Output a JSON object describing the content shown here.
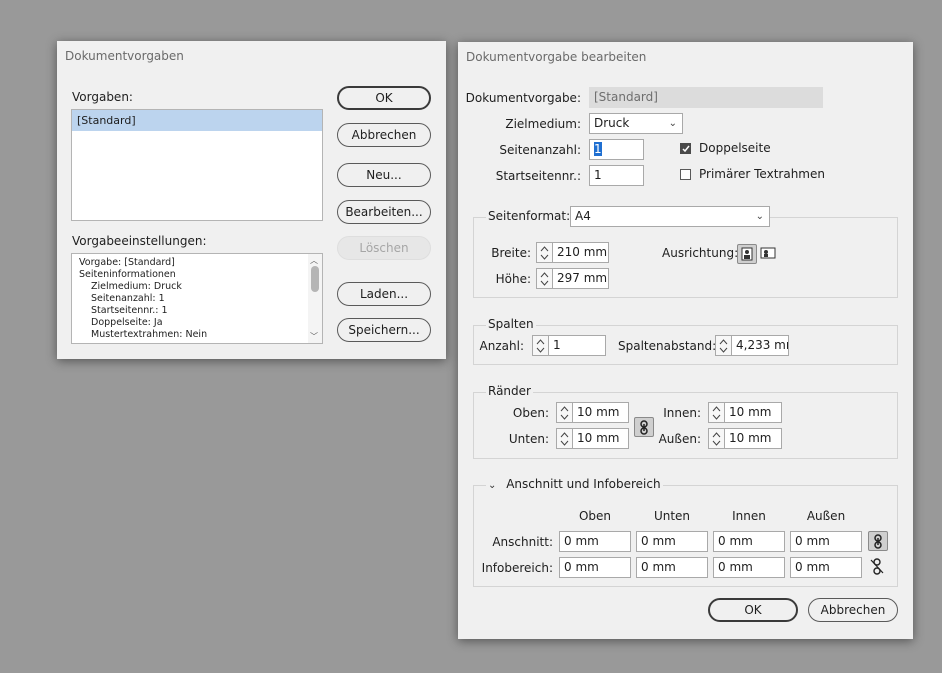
{
  "left_dialog": {
    "title": "Dokumentvorgaben",
    "presets_label": "Vorgaben:",
    "presets": [
      "[Standard]"
    ],
    "settings_label": "Vorgabeeinstellungen:",
    "settings_lines": [
      "Vorgabe: [Standard]",
      "Seiteninformationen",
      "Zielmedium: Druck",
      "Seitenanzahl: 1",
      "Startseitennr.: 1",
      "Doppelseite: Ja",
      "Mustertextrahmen: Nein"
    ],
    "buttons": {
      "ok": "OK",
      "cancel": "Abbrechen",
      "new": "Neu...",
      "edit": "Bearbeiten...",
      "delete": "Löschen",
      "load": "Laden...",
      "save": "Speichern..."
    }
  },
  "right_dialog": {
    "title": "Dokumentvorgabe bearbeiten",
    "preset_label": "Dokumentvorgabe:",
    "preset_value": "[Standard]",
    "medium_label": "Zielmedium:",
    "medium_value": "Druck",
    "page_count_label": "Seitenanzahl:",
    "page_count_value": "1",
    "start_page_label": "Startseitennr.:",
    "start_page_value": "1",
    "facing_pages_label": "Doppelseite",
    "facing_pages_checked": true,
    "primary_frame_label": "Primärer Textrahmen",
    "primary_frame_checked": false,
    "page_size_label": "Seitenformat:",
    "page_size_value": "A4",
    "width_label": "Breite:",
    "width_value": "210 mm",
    "height_label": "Höhe:",
    "height_value": "297 mm",
    "orientation_label": "Ausrichtung:",
    "columns": {
      "title": "Spalten",
      "count_label": "Anzahl:",
      "count_value": "1",
      "gutter_label": "Spaltenabstand:",
      "gutter_value": "4,233 mı"
    },
    "margins": {
      "title": "Ränder",
      "top_label": "Oben:",
      "top_value": "10 mm",
      "bottom_label": "Unten:",
      "bottom_value": "10 mm",
      "inside_label": "Innen:",
      "inside_value": "10 mm",
      "outside_label": "Außen:",
      "outside_value": "10 mm"
    },
    "bleed_slug": {
      "title": "Anschnitt und Infobereich",
      "col_headers": [
        "Oben",
        "Unten",
        "Innen",
        "Außen"
      ],
      "bleed_label": "Anschnitt:",
      "bleed_values": [
        "0 mm",
        "0 mm",
        "0 mm",
        "0 mm"
      ],
      "slug_label": "Infobereich:",
      "slug_values": [
        "0 mm",
        "0 mm",
        "0 mm",
        "0 mm"
      ]
    },
    "buttons": {
      "ok": "OK",
      "cancel": "Abbrechen"
    }
  },
  "colors": {
    "desktop": "#999999",
    "dialog_bg": "#f0f0f0",
    "list_selection": "#bcd4ee",
    "text_selection": "#1f6fd1"
  }
}
